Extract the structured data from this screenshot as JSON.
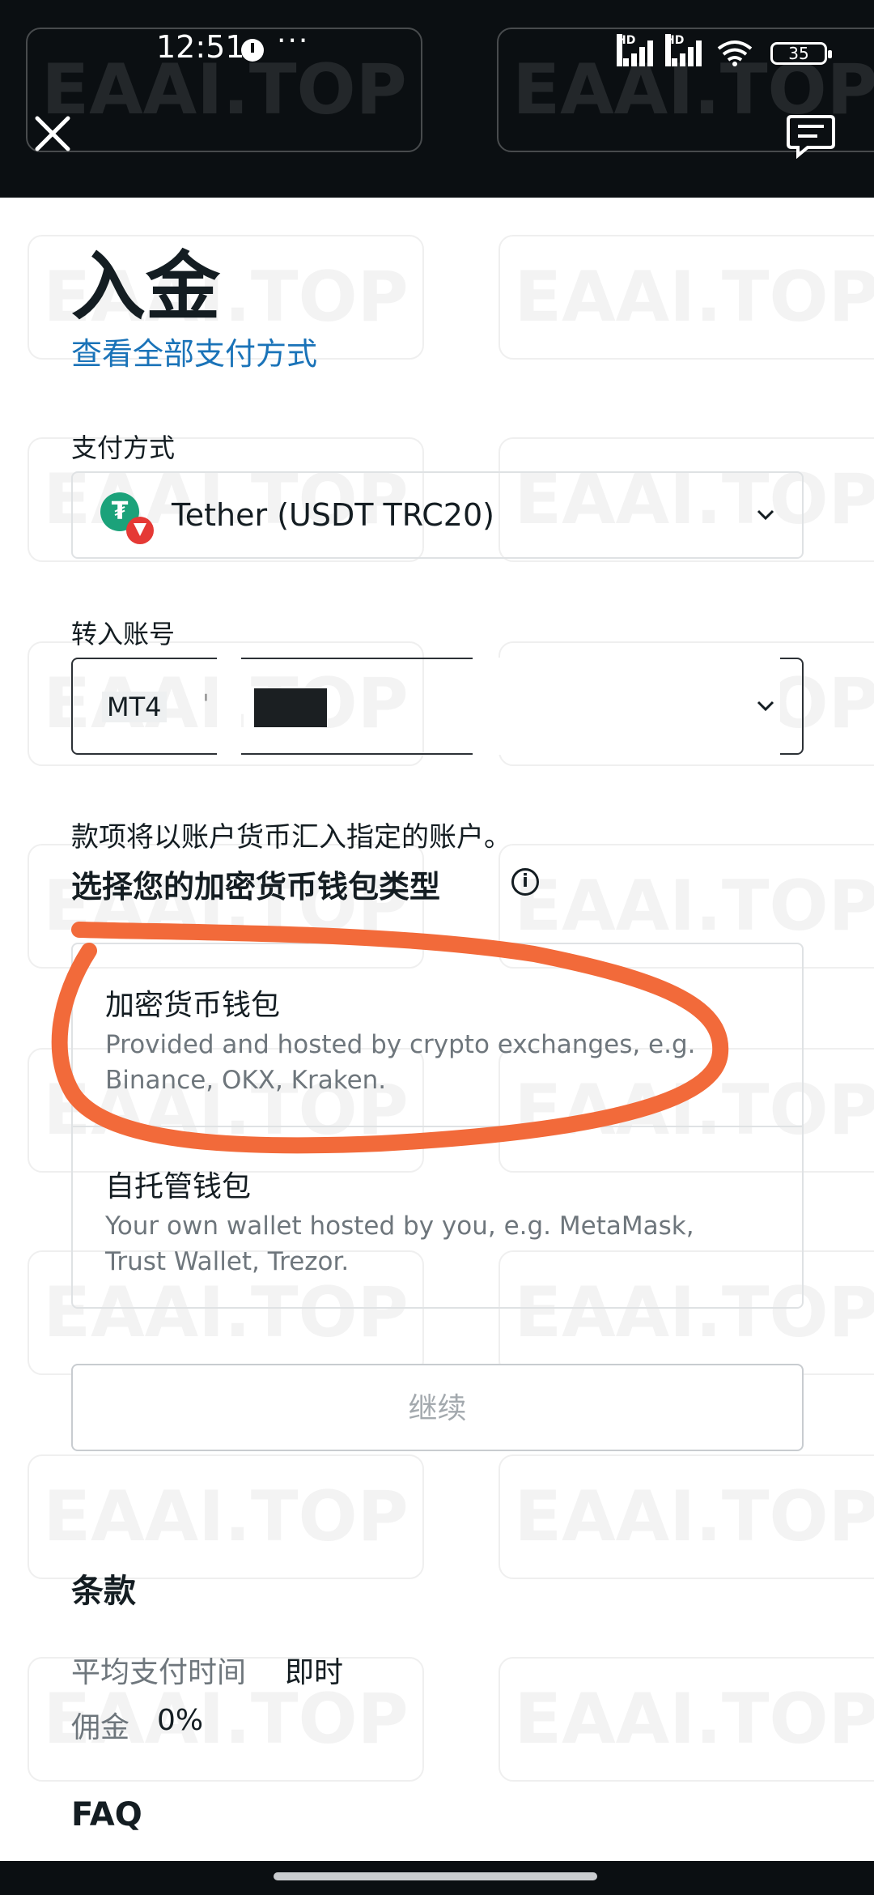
{
  "status_bar": {
    "time": "12:51",
    "dots": "···",
    "hd1": "HD",
    "hd2": "HD",
    "battery": "35"
  },
  "watermark": "EAAI.TOP",
  "header": {
    "close_icon": "close-icon",
    "feedback_icon": "chat-feedback-icon"
  },
  "page": {
    "title": "入金",
    "view_all_link": "查看全部支付方式"
  },
  "payment_method": {
    "label": "支付方式",
    "value": "Tether (USDT TRC20)",
    "icon": "tether-tron-icon"
  },
  "account": {
    "label": "转入账号",
    "prefix": "MT4",
    "mark": "'"
  },
  "note": "款项将以账户货币汇入指定的账户。",
  "wallet_type": {
    "title": "选择您的加密货币钱包类型",
    "options": [
      {
        "title": "加密货币钱包",
        "desc": "Provided and hosted by crypto exchanges, e.g. Binance, OKX, Kraken."
      },
      {
        "title": "自托管钱包",
        "desc": "Your own wallet hosted by you, e.g. MetaMask, Trust Wallet, Trezor."
      }
    ]
  },
  "continue_label": "继续",
  "terms": {
    "title": "条款",
    "avg_time_label": "平均支付时间",
    "avg_time_value": "即时",
    "commission_label": "佣金",
    "commission_value": "0%"
  },
  "faq_title": "FAQ",
  "colors": {
    "link": "#1a73b8",
    "highlight": "#f26a3a",
    "dark_bar": "#0b0f12"
  }
}
